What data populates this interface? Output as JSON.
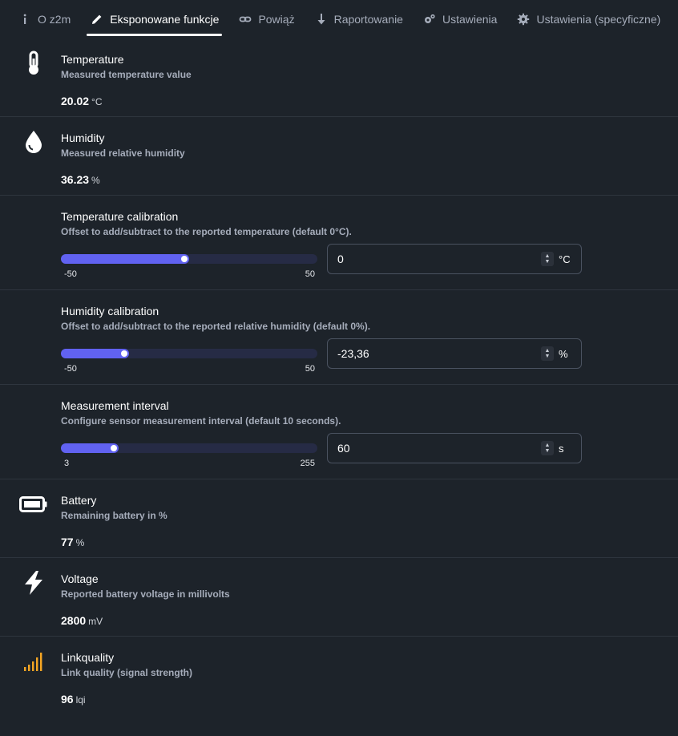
{
  "tabs": [
    {
      "label": "O z2m",
      "icon": "info-icon"
    },
    {
      "label": "Eksponowane funkcje",
      "icon": "pencil-icon",
      "active": true
    },
    {
      "label": "Powiąż",
      "icon": "link-icon"
    },
    {
      "label": "Raportowanie",
      "icon": "arrow-down-icon"
    },
    {
      "label": "Ustawienia",
      "icon": "gears-icon"
    },
    {
      "label": "Ustawienia (specyficzne)",
      "icon": "gear-icon"
    }
  ],
  "features": {
    "temperature": {
      "title": "Temperature",
      "desc": "Measured temperature value",
      "value": "20.02",
      "unit": "°C",
      "icon": "thermometer-icon"
    },
    "humidity": {
      "title": "Humidity",
      "desc": "Measured relative humidity",
      "value": "36.23",
      "unit": "%",
      "icon": "droplet-icon"
    },
    "temp_calibration": {
      "title": "Temperature calibration",
      "desc": "Offset to add/subtract to the reported temperature (default 0°C).",
      "min": "-50",
      "max": "50",
      "input_value": "0",
      "unit": "°C",
      "level": 0.5
    },
    "humidity_calibration": {
      "title": "Humidity calibration",
      "desc": "Offset to add/subtract to the reported relative humidity (default 0%).",
      "min": "-50",
      "max": "50",
      "input_value": "-23,36",
      "unit": "%",
      "level": 0.2664
    },
    "measurement_interval": {
      "title": "Measurement interval",
      "desc": "Configure sensor measurement interval (default 10 seconds).",
      "min": "3",
      "max": "255",
      "input_value": "60",
      "unit": "s",
      "level": 0.226
    },
    "battery": {
      "title": "Battery",
      "desc": "Remaining battery in %",
      "value": "77",
      "unit": "%",
      "icon": "battery-icon"
    },
    "voltage": {
      "title": "Voltage",
      "desc": "Reported battery voltage in millivolts",
      "value": "2800",
      "unit": "mV",
      "icon": "bolt-icon"
    },
    "linkquality": {
      "title": "Linkquality",
      "desc": "Link quality (signal strength)",
      "value": "96",
      "unit": "lqi",
      "icon": "signal-icon"
    }
  },
  "colors": {
    "accent": "#6162f1",
    "linkquality_icon": "#f5a623",
    "background": "#1d232a"
  }
}
